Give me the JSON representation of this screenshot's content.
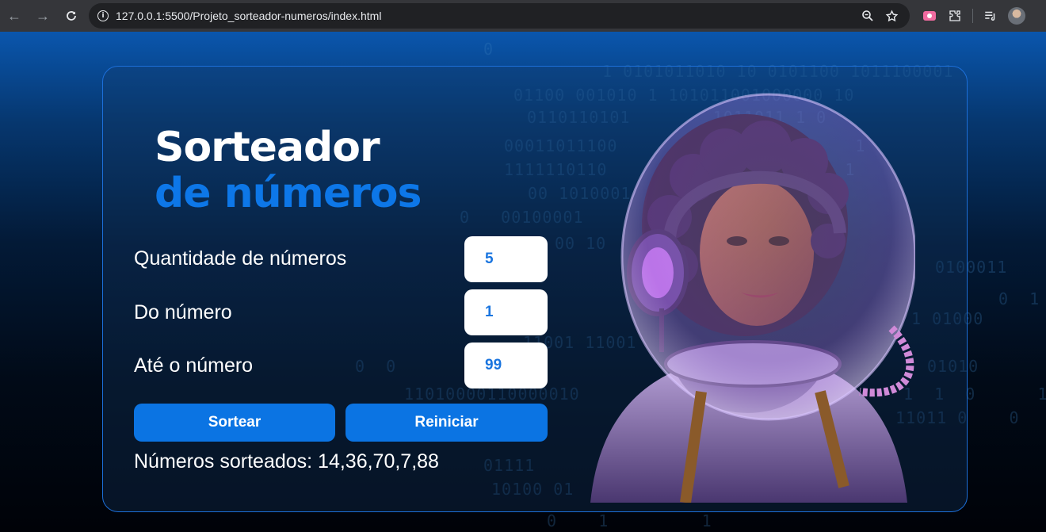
{
  "browser": {
    "url": "127.0.0.1:5500/Projeto_sorteador-numeros/index.html",
    "back_icon": "arrow-left-icon",
    "forward_icon": "arrow-right-icon",
    "reload_icon": "reload-icon"
  },
  "title": {
    "line1": "Sorteador",
    "line2": "de números"
  },
  "form": {
    "quantity_label": "Quantidade de números",
    "quantity_value": "5",
    "from_label": "Do número",
    "from_value": "1",
    "to_label": "Até o número",
    "to_value": "99"
  },
  "buttons": {
    "draw_label": "Sortear",
    "reset_label": "Reiniciar"
  },
  "result": {
    "text": "Números sorteados: 14,36,70,7,88"
  },
  "colors": {
    "accent": "#0b74e3",
    "title_white": "#ffffff",
    "title_blue": "#0d77e8",
    "input_text": "#1a75df",
    "card_border": "#1c6fd9"
  }
}
